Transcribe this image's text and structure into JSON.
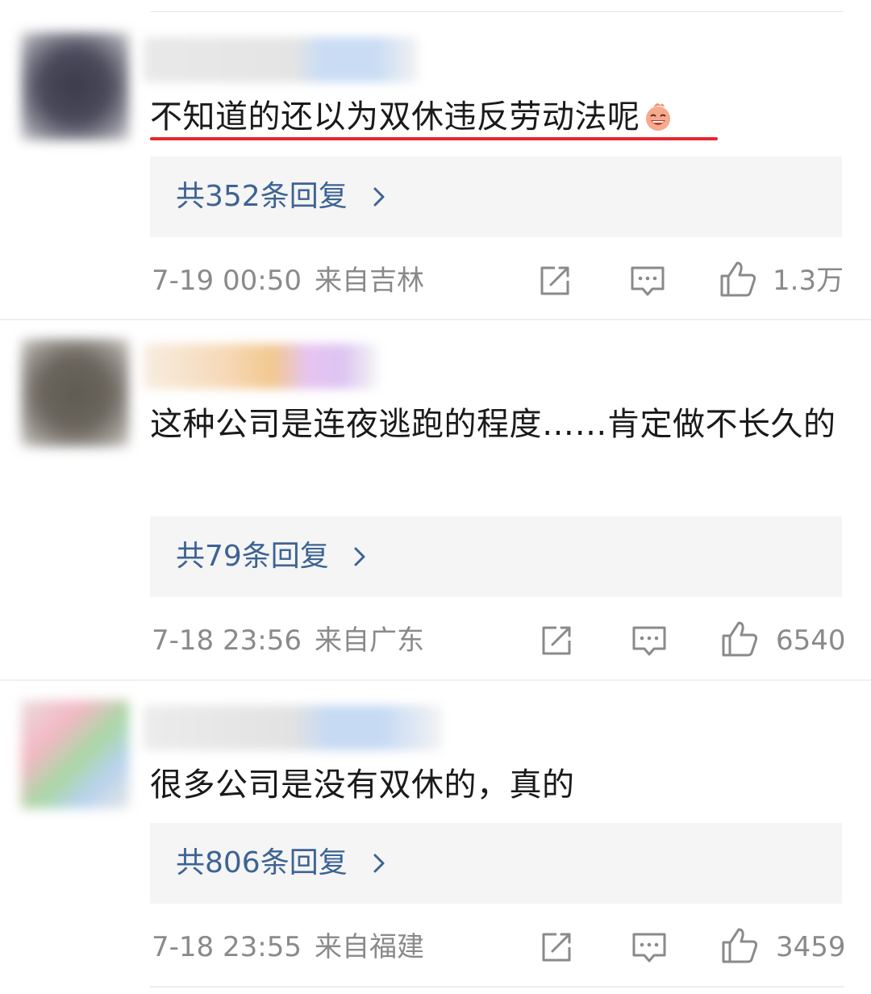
{
  "comments": [
    {
      "text": "不知道的还以为双休违反劳动法呢",
      "emoji": "laughing-face-icon",
      "replies_label": "共352条回复",
      "date": "7-19 00:50",
      "location": "来自吉林",
      "likes": "1.3万"
    },
    {
      "text": "这种公司是连夜逃跑的程度……肯定做不长久的",
      "replies_label": "共79条回复",
      "date": "7-18 23:56",
      "location": "来自广东",
      "likes": "6540"
    },
    {
      "text": "很多公司是没有双休的，真的",
      "replies_label": "共806条回复",
      "date": "7-18 23:55",
      "location": "来自福建",
      "likes": "3459"
    }
  ],
  "colors": {
    "reply_link": "#3d6394",
    "underline": "#e8262f",
    "meta_text": "#8a8a8a",
    "reply_bg": "#f5f5f5"
  }
}
